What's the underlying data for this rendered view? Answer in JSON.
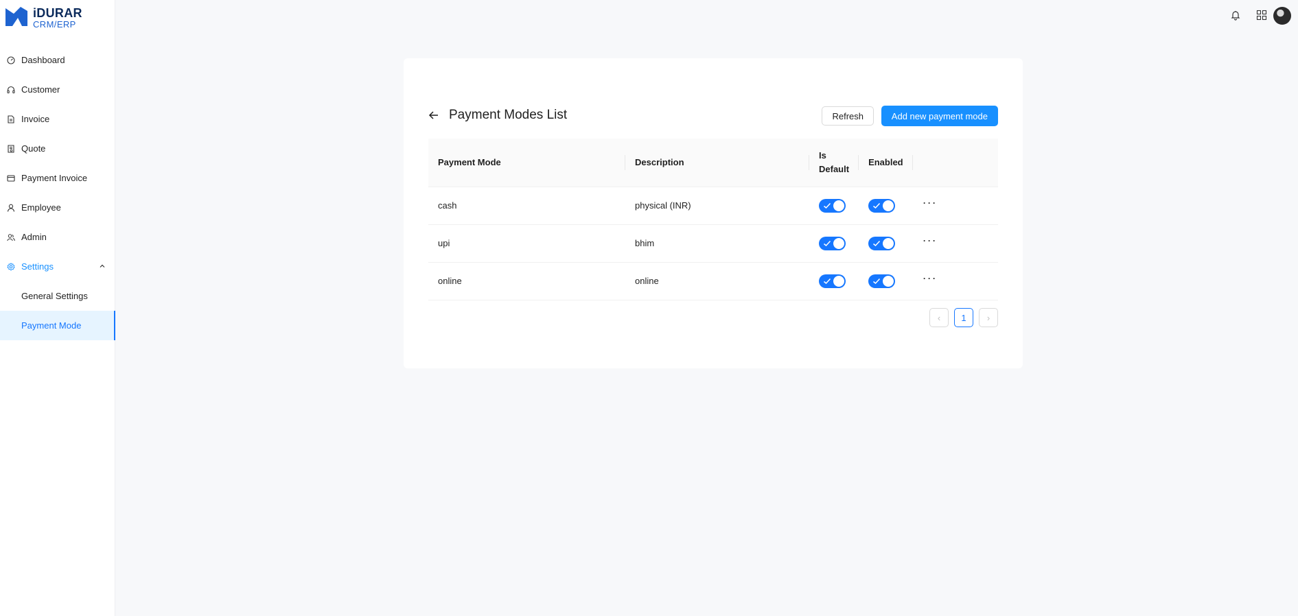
{
  "brand": {
    "title": "iDURAR",
    "subtitle": "CRM/ERP",
    "color": "#1e63d0"
  },
  "sidebar": {
    "items": [
      {
        "label": "Dashboard",
        "icon": "dashboard-icon"
      },
      {
        "label": "Customer",
        "icon": "headset-icon"
      },
      {
        "label": "Invoice",
        "icon": "file-icon"
      },
      {
        "label": "Quote",
        "icon": "file-sync-icon"
      },
      {
        "label": "Payment Invoice",
        "icon": "credit-card-icon"
      },
      {
        "label": "Employee",
        "icon": "user-icon"
      },
      {
        "label": "Admin",
        "icon": "team-icon"
      },
      {
        "label": "Settings",
        "icon": "gear-icon",
        "expanded": true
      }
    ],
    "settings_children": [
      {
        "label": "General Settings"
      },
      {
        "label": "Payment Mode",
        "selected": true
      }
    ]
  },
  "header": {
    "icons": [
      "bell-icon",
      "apps-icon",
      "avatar"
    ]
  },
  "page": {
    "title": "Payment Modes List",
    "refresh_label": "Refresh",
    "add_label": "Add new payment mode",
    "accent": "#1890ff"
  },
  "table": {
    "headers": {
      "mode": "Payment Mode",
      "description": "Description",
      "is_default_1": "Is",
      "is_default_2": "Default",
      "enabled": "Enabled"
    },
    "rows": [
      {
        "mode": "cash",
        "description": "physical (INR)",
        "is_default": true,
        "enabled": true
      },
      {
        "mode": "upi",
        "description": "bhim",
        "is_default": true,
        "enabled": true
      },
      {
        "mode": "online",
        "description": "online",
        "is_default": true,
        "enabled": true
      }
    ],
    "actions_glyph": "···"
  },
  "pagination": {
    "current_page": "1",
    "prev": "‹",
    "next": "›"
  }
}
